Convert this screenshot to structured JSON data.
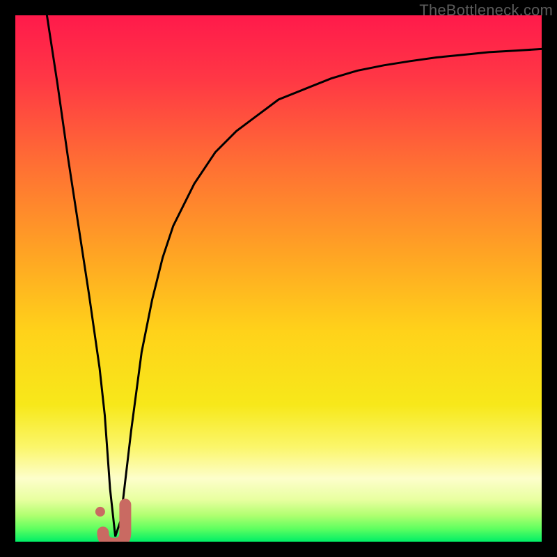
{
  "watermark": "TheBottleneck.com",
  "colors": {
    "frame": "#000000",
    "curve": "#000000",
    "marker": "#c96a62",
    "gradient_stops": [
      {
        "offset": 0.0,
        "color": "#ff1a4b"
      },
      {
        "offset": 0.12,
        "color": "#ff3745"
      },
      {
        "offset": 0.28,
        "color": "#ff6e34"
      },
      {
        "offset": 0.45,
        "color": "#ffa324"
      },
      {
        "offset": 0.6,
        "color": "#ffd21a"
      },
      {
        "offset": 0.74,
        "color": "#f7e81a"
      },
      {
        "offset": 0.82,
        "color": "#fbf66a"
      },
      {
        "offset": 0.88,
        "color": "#fdfecb"
      },
      {
        "offset": 0.92,
        "color": "#e8ffa0"
      },
      {
        "offset": 0.95,
        "color": "#b0ff70"
      },
      {
        "offset": 0.975,
        "color": "#60ff60"
      },
      {
        "offset": 1.0,
        "color": "#00ee66"
      }
    ]
  },
  "chart_data": {
    "type": "line",
    "title": "",
    "xlabel": "",
    "ylabel": "",
    "xlim": [
      0,
      100
    ],
    "ylim": [
      0,
      100
    ],
    "grid": false,
    "legend": false,
    "series": [
      {
        "name": "bottleneck-curve",
        "x": [
          6,
          8,
          10,
          12,
          14,
          16,
          17,
          18,
          19,
          20,
          22,
          24,
          26,
          28,
          30,
          34,
          38,
          42,
          46,
          50,
          55,
          60,
          65,
          70,
          75,
          80,
          85,
          90,
          95,
          100
        ],
        "values": [
          100,
          87,
          73,
          60,
          47,
          33,
          24,
          10,
          1,
          4,
          21,
          36,
          46,
          54,
          60,
          68,
          74,
          78,
          81,
          84,
          86,
          88,
          89.5,
          90.5,
          91.3,
          92,
          92.5,
          93,
          93.3,
          93.6
        ]
      }
    ],
    "marker": {
      "name": "optimal-point",
      "shape": "j-hook",
      "x": 18.5,
      "y": 2,
      "color": "#c96a62"
    },
    "annotations": []
  }
}
